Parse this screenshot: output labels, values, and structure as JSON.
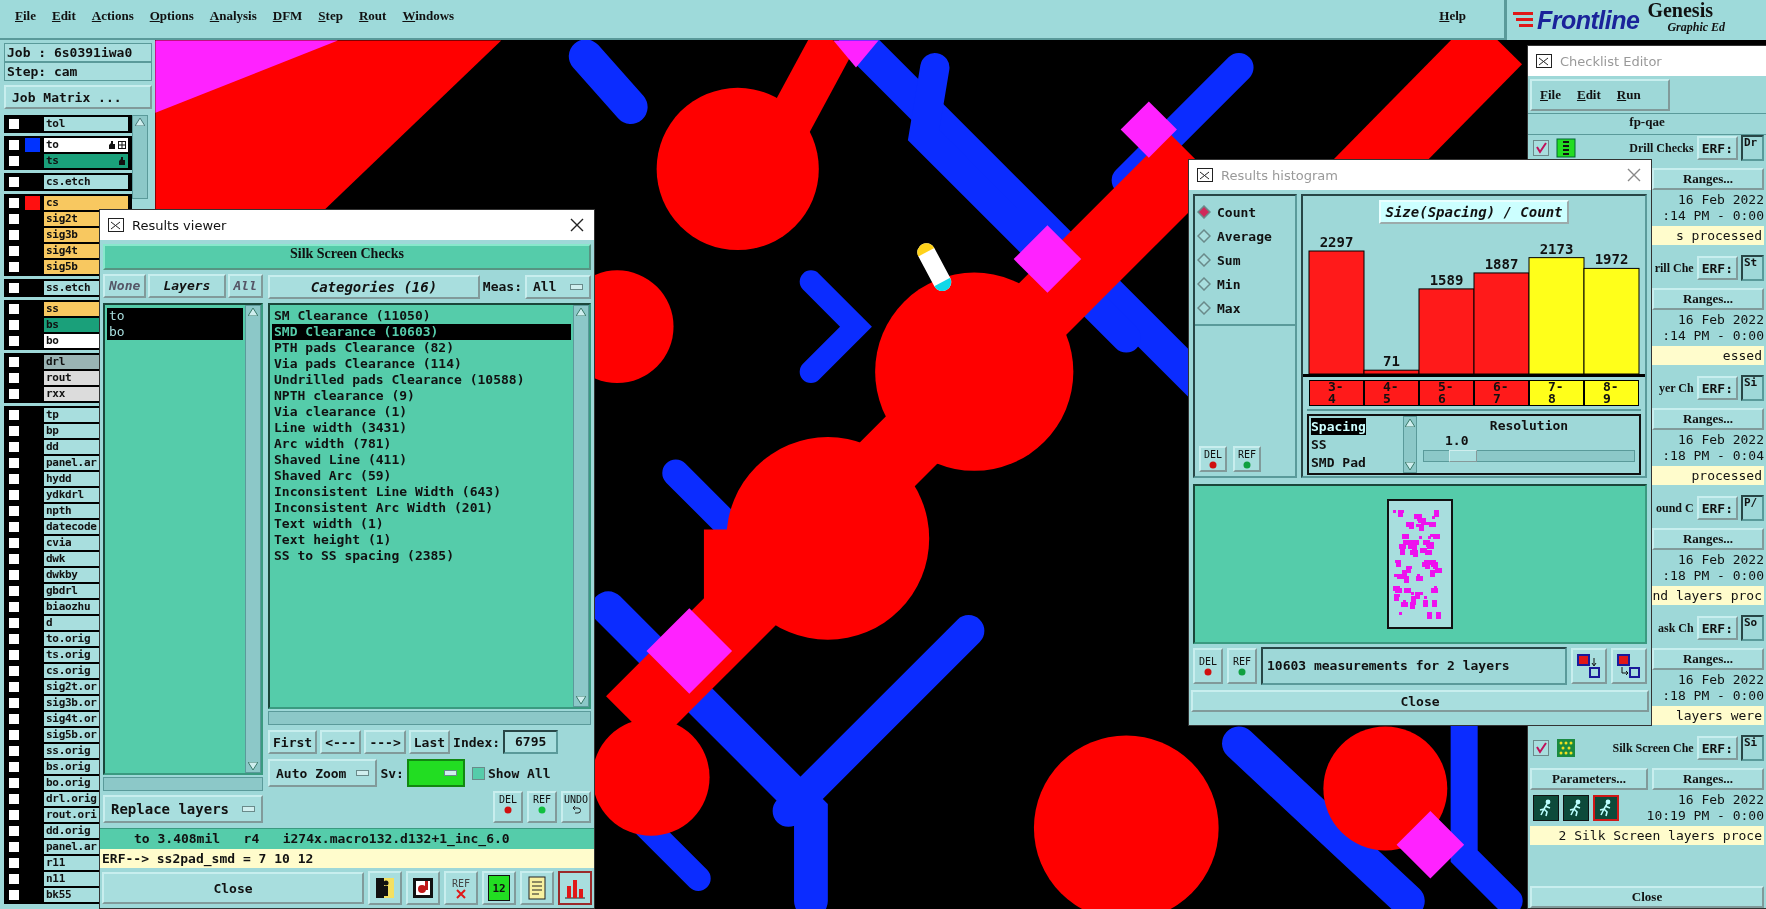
{
  "menu_bar": {
    "items": [
      "File",
      "Edit",
      "Actions",
      "Options",
      "Analysis",
      "DFM",
      "Step",
      "Rout",
      "Windows"
    ],
    "help": "Help"
  },
  "logo": {
    "brand": "Frontline",
    "product": "Genesis",
    "subtitle": "Graphic Ed"
  },
  "job_panel": {
    "job": "Job : 6s0391iwa0",
    "step": "Step: cam",
    "matrix_button": "Job Matrix ..."
  },
  "layer_groups": [
    [
      {
        "name": "tol",
        "kind": "misc",
        "checked": false
      }
    ],
    [
      {
        "name": "to",
        "kind": "silk",
        "checked": false,
        "color": "#0033ff",
        "affected": true,
        "work": true
      },
      {
        "name": "ts",
        "kind": "mask",
        "checked": false,
        "affected": true
      }
    ],
    [
      {
        "name": "cs.etch",
        "kind": "misc",
        "checked": false
      }
    ],
    [
      {
        "name": "cs",
        "kind": "signal",
        "checked": false,
        "color": "#ff1010"
      },
      {
        "name": "sig2t",
        "kind": "signal",
        "checked": false
      },
      {
        "name": "sig3b",
        "kind": "signal",
        "checked": false
      },
      {
        "name": "sig4t",
        "kind": "signal",
        "checked": false
      },
      {
        "name": "sig5b",
        "kind": "signal",
        "checked": false
      }
    ],
    [
      {
        "name": "ss.etch",
        "kind": "misc",
        "checked": false
      }
    ],
    [
      {
        "name": "ss",
        "kind": "signal",
        "checked": false
      },
      {
        "name": "bs",
        "kind": "mask",
        "checked": false
      },
      {
        "name": "bo",
        "kind": "silk",
        "checked": false
      }
    ],
    [
      {
        "name": "drl",
        "kind": "drill",
        "checked": false
      },
      {
        "name": "rout",
        "kind": "rout",
        "checked": false
      },
      {
        "name": "rxx",
        "kind": "rout",
        "checked": false
      }
    ],
    [
      {
        "name": "tp",
        "kind": "misc",
        "checked": false
      },
      {
        "name": "bp",
        "kind": "misc",
        "checked": false
      },
      {
        "name": "dd",
        "kind": "misc",
        "checked": false
      },
      {
        "name": "panel.ar",
        "kind": "misc",
        "checked": false
      },
      {
        "name": "hydd",
        "kind": "misc",
        "checked": false
      },
      {
        "name": "ydkdrl",
        "kind": "misc",
        "checked": false
      },
      {
        "name": "npth",
        "kind": "misc",
        "checked": false
      },
      {
        "name": "datecode",
        "kind": "misc",
        "checked": false
      },
      {
        "name": "cvia",
        "kind": "misc",
        "checked": false
      },
      {
        "name": "dwk",
        "kind": "misc",
        "checked": false
      },
      {
        "name": "dwkby",
        "kind": "misc",
        "checked": false
      },
      {
        "name": "gbdrl",
        "kind": "misc",
        "checked": false
      },
      {
        "name": "biaozhu",
        "kind": "misc",
        "checked": false
      },
      {
        "name": "d",
        "kind": "misc",
        "checked": false
      },
      {
        "name": "to.orig",
        "kind": "misc",
        "checked": false
      },
      {
        "name": "ts.orig",
        "kind": "misc",
        "checked": false
      },
      {
        "name": "cs.orig",
        "kind": "misc",
        "checked": false
      },
      {
        "name": "sig2t.or",
        "kind": "misc",
        "checked": false
      },
      {
        "name": "sig3b.or",
        "kind": "misc",
        "checked": false
      },
      {
        "name": "sig4t.or",
        "kind": "misc",
        "checked": false
      },
      {
        "name": "sig5b.or",
        "kind": "misc",
        "checked": false
      },
      {
        "name": "ss.orig",
        "kind": "misc",
        "checked": false
      },
      {
        "name": "bs.orig",
        "kind": "misc",
        "checked": false
      },
      {
        "name": "bo.orig",
        "kind": "misc",
        "checked": false
      },
      {
        "name": "drl.orig",
        "kind": "misc",
        "checked": false
      },
      {
        "name": "rout.ori",
        "kind": "misc",
        "checked": false
      },
      {
        "name": "dd.orig",
        "kind": "misc",
        "checked": false
      },
      {
        "name": "panel.ar",
        "kind": "misc",
        "checked": false
      },
      {
        "name": "r11",
        "kind": "misc",
        "checked": false
      },
      {
        "name": "n11",
        "kind": "misc",
        "checked": false
      },
      {
        "name": "bk55",
        "kind": "misc",
        "checked": false
      }
    ]
  ],
  "results_viewer": {
    "title": "Results viewer",
    "active": true,
    "header": "Silk Screen Checks",
    "layer_buttons": [
      "None",
      "Layers",
      "All"
    ],
    "layers": [
      {
        "name": "to",
        "selected": true
      },
      {
        "name": "bo",
        "selected": true
      }
    ],
    "replace_mode": "Replace layers",
    "categories_button": "Categories (16)",
    "meas_label": "Meas:",
    "meas_value": "All",
    "categories": [
      {
        "label": "SM Clearance (11050)",
        "selected": false
      },
      {
        "label": "SMD Clearance (10603)",
        "selected": true
      },
      {
        "label": "PTH pads Clearance (82)",
        "selected": false
      },
      {
        "label": "Via pads Clearance (114)",
        "selected": false
      },
      {
        "label": "Undrilled pads Clearance (10588)",
        "selected": false
      },
      {
        "label": "NPTH clearance (9)",
        "selected": false
      },
      {
        "label": "Via clearance (1)",
        "selected": false
      },
      {
        "label": "Line width (3431)",
        "selected": false
      },
      {
        "label": "Arc width (781)",
        "selected": false
      },
      {
        "label": "Shaved Line (411)",
        "selected": false
      },
      {
        "label": "Shaved Arc (59)",
        "selected": false
      },
      {
        "label": "Inconsistent Line Width (643)",
        "selected": false
      },
      {
        "label": "Inconsistent Arc Width (201)",
        "selected": false
      },
      {
        "label": "Text width (1)",
        "selected": false
      },
      {
        "label": "Text height (1)",
        "selected": false
      },
      {
        "label": "SS to SS spacing (2385)",
        "selected": false
      }
    ],
    "nav": [
      "First",
      "<---",
      "--->",
      "Last"
    ],
    "index_label": "Index:",
    "index": "6795",
    "zoom_mode": "Auto Zoom",
    "sv_label": "Sv:",
    "show_all": {
      "label": "Show All",
      "checked": false
    },
    "edit_buttons": [
      "DEL",
      "REF",
      "UNDO"
    ],
    "status": "to 3.408mil   r4   i274x.macro132.d132+1_inc_6.0",
    "erf": "ERF--> ss2pad_smd = 7 10 12",
    "close": "Close",
    "tools": [
      {
        "kind": "exit"
      },
      {
        "kind": "stamp"
      },
      {
        "kind": "ref_off",
        "label": "REF"
      },
      {
        "kind": "pages",
        "label": "12"
      },
      {
        "kind": "notes"
      },
      {
        "kind": "histogram"
      }
    ]
  },
  "histogram": {
    "title": "Results histogram",
    "active": false,
    "modes": [
      {
        "label": "Count",
        "selected": true
      },
      {
        "label": "Average",
        "selected": false
      },
      {
        "label": "Sum",
        "selected": false
      },
      {
        "label": "Min",
        "selected": false
      },
      {
        "label": "Max",
        "selected": false
      }
    ],
    "buttons": [
      "DEL",
      "REF"
    ],
    "chart_data": {
      "type": "bar",
      "title": "Size(Spacing) / Count",
      "categories": [
        "3-4",
        "4-5",
        "5-6",
        "6-7",
        "7-8",
        "8-9"
      ],
      "values": [
        2297,
        71,
        1589,
        1887,
        2173,
        1972
      ],
      "data_labels": true
    },
    "bins": [
      {
        "color": "#ff1a1a"
      },
      {
        "color": "#ff1a1a"
      },
      {
        "color": "#ff1a1a"
      },
      {
        "color": "#ff1a1a"
      },
      {
        "color": "#ffff1a"
      },
      {
        "color": "#ffff1a"
      }
    ],
    "measures": [
      {
        "label": "Spacing",
        "selected": true
      },
      {
        "label": "SS",
        "selected": false
      },
      {
        "label": "SMD Pad",
        "selected": false
      }
    ],
    "resolution": {
      "label": "Resolution",
      "value": "1.0",
      "level": 0.12
    },
    "footer_buttons": [
      "DEL",
      "REF"
    ],
    "summary": "10603 measurements for 2 layers",
    "close": "Close"
  },
  "checklist": {
    "title": "Checklist Editor",
    "active": false,
    "menus": [
      "File",
      "Edit",
      "Run"
    ],
    "name": "fp-qae",
    "items": [
      {
        "name": "Drill Checks",
        "checked": true,
        "kind": "drill",
        "erf_label": "ERF:",
        "erf_value": "Dr",
        "ranges": "Ranges...",
        "date": "16 Feb 2022",
        "time": ":14 PM - 0:00",
        "status": "s processed"
      },
      {
        "name": "rill Che",
        "erf_label": "ERF:",
        "erf_value": "St",
        "ranges": "Ranges...",
        "date": "16 Feb 2022",
        "time": ":14 PM - 0:00",
        "status": "essed"
      },
      {
        "name": "yer Ch",
        "erf_label": "ERF:",
        "erf_value": "Si",
        "ranges": "Ranges...",
        "date": "16 Feb 2022",
        "time": ":18 PM - 0:04",
        "status": "processed"
      },
      {
        "name": "ound C",
        "erf_label": "ERF:",
        "erf_value": "P/",
        "ranges": "Ranges...",
        "date": "16 Feb 2022",
        "time": ":18 PM - 0:00",
        "status": "nd layers proc"
      },
      {
        "name": "ask Ch",
        "erf_label": "ERF:",
        "erf_value": "So",
        "ranges": "Ranges...",
        "date": "16 Feb 2022",
        "time": ":18 PM - 0:00",
        "status": "layers were"
      },
      {
        "name": "Silk Screen Che",
        "checked": true,
        "kind": "silk",
        "erf_label": "ERF:",
        "erf_value": "Si",
        "parameters": "Parameters...",
        "ranges": "Ranges...",
        "date": "16 Feb 2022",
        "time": "10:19 PM - 0:00",
        "status": "2 Silk Screen layers proce"
      }
    ],
    "close": "Close"
  }
}
